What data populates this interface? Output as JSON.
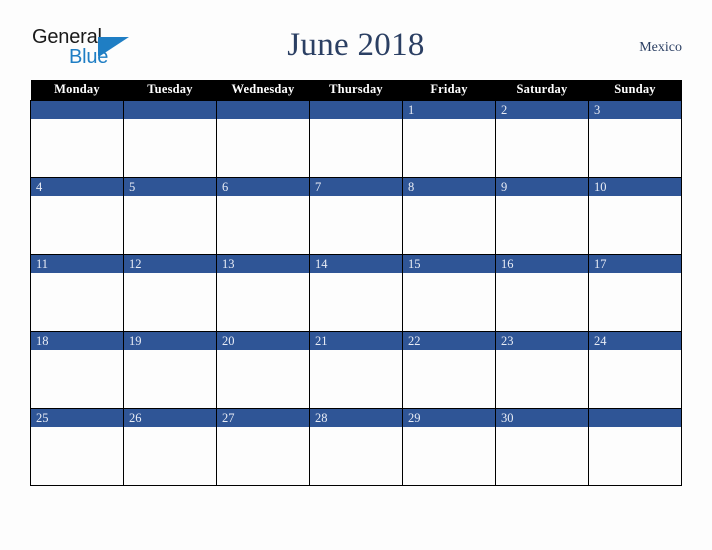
{
  "logo": {
    "word1": "General",
    "word2": "Blue",
    "triangle_color": "#1f7ec4",
    "word1_color": "#1a1a1a",
    "word2_color": "#1f7ec4"
  },
  "header": {
    "title": "June 2018",
    "country": "Mexico",
    "title_color": "#2b3f63"
  },
  "calendar": {
    "month": "June",
    "year": "2018",
    "header_bg": "#000000",
    "header_fg": "#ffffff",
    "daybar_bg": "#2f5596",
    "daybar_fg": "#e8ecf5",
    "cell_bg": "#fdfdfd",
    "border_color": "#000000",
    "weekdays": [
      "Monday",
      "Tuesday",
      "Wednesday",
      "Thursday",
      "Friday",
      "Saturday",
      "Sunday"
    ],
    "weeks": [
      [
        "",
        "",
        "",
        "",
        "1",
        "2",
        "3"
      ],
      [
        "4",
        "5",
        "6",
        "7",
        "8",
        "9",
        "10"
      ],
      [
        "11",
        "12",
        "13",
        "14",
        "15",
        "16",
        "17"
      ],
      [
        "18",
        "19",
        "20",
        "21",
        "22",
        "23",
        "24"
      ],
      [
        "25",
        "26",
        "27",
        "28",
        "29",
        "30",
        ""
      ]
    ]
  }
}
